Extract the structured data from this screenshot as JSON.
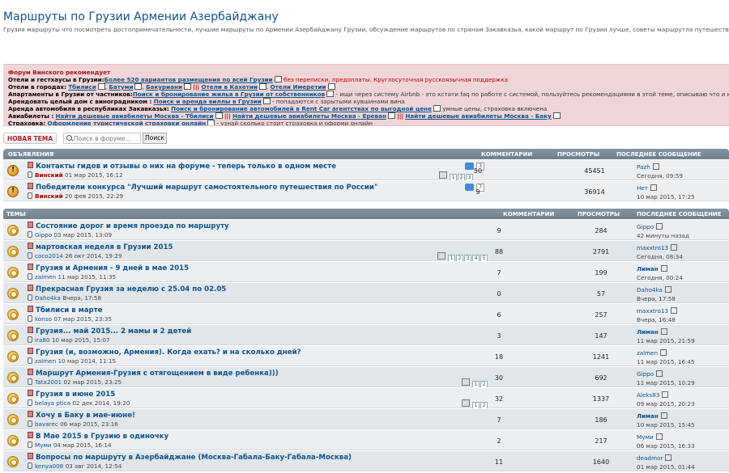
{
  "site": {
    "title": "Маршруты по Грузии Армении Азербайджану",
    "description": "Грузия маршруты что посмотреть достопримечательности, лучшие маршруты по Армении Азербайджану Грузии, обсуждение маршрутов по странам Закавказья, какой маршрут по Грузии лучше, советы маршрутла путешествия Грузия Армения Азербайджан, что посмотреть в Армении Азербайджане, достопримечательности Тбилиси, что посмотреть в Баку, Ереван достопримечательности"
  },
  "promo": {
    "heading": "Форум Винского рекомендует",
    "hotels_label": "Отели и гестхаусы в Грузии:",
    "hotels_link": "Более 520 вариантов размещения по всей Грузии",
    "hotels_note": "без переписки, предоплаты. Круглосуточная русскоязычная поддержка",
    "cities_label": "Отели в городах:",
    "city_tbilisi": "Тбилиси",
    "city_batumi": "Батуми",
    "city_bakuriani": "Бакуриани",
    "pipes": "|||",
    "city_kakheti": "Отели в Кахетии",
    "city_imereti": "Отели Имеретии",
    "apts_label": "Апартаменты в Грузии от частников:",
    "apts_link": "Поиск и бронирование жилья в Грузии от собственников",
    "apts_note": "- ищи через систему Airbnb - это кстати faq по работе с системой, пользуйтесь рекомендациями в этой теме, описываю что и как делать",
    "villa_label": "Арендовать целый дом с виноградником :",
    "villa_link": "Поиск и аренда виллы в Грузии",
    "villa_note": "- попадаются с зарытыми кувшинами вина",
    "car_label": "Аренда автомобиля в республиках Закавказья:",
    "car_link": "Поиск и бронирование автомобилей в Rent Car агентствах по выгодной цене",
    "car_note": "умные цены, страховка включена",
    "avia_label": "Авиабилеты :",
    "avia_1": "Найти дешевые авиабилеты Москва - Тбилиси",
    "avia_2": "Найти дешевые авиабилеты Москва - Ереван",
    "avia_3": "Найти дешевые авиабилеты Москва - Баку",
    "ins_label": "Страховка:",
    "ins_link": "Оформление туристической страховки онлайн",
    "ins_note": "- узнай сколько стоит страховка и оформи онлайн"
  },
  "toolbar": {
    "new_topic": "НОВАЯ ТЕМА",
    "search_placeholder": "Поиск в форуме...",
    "search_button": "Поиск"
  },
  "announcements": {
    "header": {
      "title": "ОБЪЯВЛЕНИЯ",
      "replies": "КОММЕНТАРИИ",
      "views": "ПРОСМОТРЫ",
      "last": "ПОСЛЕДНЕЕ СООБЩЕНИЕ"
    },
    "rows": [
      {
        "title": "Контакты гидов и отзывы о них на форуме - теперь только в одном месте",
        "author": "Винский",
        "date": "01 мар 2015, 16:12",
        "likes": "3",
        "pages": [
          "1",
          "2",
          "3"
        ],
        "replies": "50",
        "views": "45451",
        "last_user": "Pazh",
        "last_time": "Сегодня, 09:59"
      },
      {
        "title": "Победители конкурса \"Лучший маршрут самостоятельного путешествия по России\"",
        "author": "Винский",
        "date": "20 фев 2015, 22:29",
        "likes": "7",
        "pages": [],
        "replies": "9",
        "views": "36914",
        "last_user": "Нет",
        "last_time": "10 мар 2015, 17:25"
      }
    ]
  },
  "topics": {
    "header": {
      "title": "ТЕМЫ",
      "replies": "КОММЕНТАРИИ",
      "views": "ПРОСМОТРЫ",
      "last": "ПОСЛЕДНЕЕ СООБЩЕНИЕ"
    },
    "rows": [
      {
        "title": "Состояние дорог и время проезда по маршруту",
        "author": "Gippo",
        "date": "03 мар 2015, 13:09",
        "pages": [],
        "replies": "9",
        "views": "284",
        "last_user": "Gippo",
        "last_time": "42 минуты назад"
      },
      {
        "title": "мартовская неделя в Грузии 2015",
        "author": "coco2014",
        "date": "26 окт 2014, 19:29",
        "pages": [
          "1",
          "2",
          "3",
          "4",
          "5"
        ],
        "replies": "88",
        "views": "2791",
        "last_user": "maxxtro13",
        "last_time": "Сегодня, 08:34"
      },
      {
        "title": "Грузия и Армения - 9 дней в мае 2015",
        "author": "zalmen",
        "date": "11 мар 2015, 11:35",
        "pages": [],
        "replies": "7",
        "views": "199",
        "last_user": "Лиман",
        "last_time": "Сегодня, 00:24"
      },
      {
        "title": "Прекрасная Грузия за неделю с 25.04 по 02.05",
        "author": "Daho4ka",
        "date": "Вчера, 17:58",
        "pages": [],
        "replies": "0",
        "views": "57",
        "last_user": "Daho4ka",
        "last_time": "Вчера, 17:58"
      },
      {
        "title": "Тбилиси в марте",
        "author": "konso",
        "date": "07 мар 2015, 23:35",
        "pages": [],
        "replies": "6",
        "views": "257",
        "last_user": "maxxtro13",
        "last_time": "Вчера, 16:48"
      },
      {
        "title": "Грузия... май 2015... 2 мамы и 2 детей",
        "author": "ira80",
        "date": "10 мар 2015, 15:07",
        "pages": [],
        "replies": "3",
        "views": "147",
        "last_user": "Лиман",
        "last_time": "11 мар 2015, 21:59"
      },
      {
        "title": "Грузия (и, возможно, Армения). Когда ехать? и на сколько дней?",
        "author": "zalmen",
        "date": "10 мар 2014, 11:15",
        "pages": [],
        "replies": "18",
        "views": "1241",
        "last_user": "zalmen",
        "last_time": "11 мар 2015, 16:45"
      },
      {
        "title": "Маршрут Армения-Грузия с отягощением в виде ребенка)))",
        "author": "Tata2001",
        "date": "02 мар 2015, 23:25",
        "pages": [
          "1",
          "2"
        ],
        "replies": "30",
        "views": "692",
        "last_user": "Gippo",
        "last_time": "11 мар 2015, 10:29"
      },
      {
        "title": "Грузия в июне 2015",
        "author": "belaya ptica",
        "date": "02 дек 2014, 19:20",
        "pages": [
          "1",
          "2"
        ],
        "replies": "32",
        "views": "1337",
        "last_user": "Aleks83",
        "last_time": "09 мар 2015, 20:23"
      },
      {
        "title": "Хочу в Баку в мае-июне!",
        "author": "bavarec",
        "date": "06 мар 2015, 23:16",
        "pages": [],
        "replies": "7",
        "views": "186",
        "last_user": "Лиман",
        "last_time": "10 мар 2015, 15:45"
      },
      {
        "title": "В Мае 2015 в Грузию в одиночку",
        "author": "Муми",
        "date": "04 мар 2015, 16:14",
        "pages": [],
        "replies": "2",
        "views": "217",
        "last_user": "Муми",
        "last_time": "06 мар 2015, 16:33"
      },
      {
        "title": "Вопросы по маршруту в Азербайджане (Москва-Габала-Баку-Габала-Москва)",
        "author": "kenya008",
        "date": "03 авг 2014, 12:54",
        "pages": [],
        "replies": "11",
        "views": "1640",
        "last_user": "deadmor",
        "last_time": "01 мар 2015, 01:44"
      }
    ]
  }
}
